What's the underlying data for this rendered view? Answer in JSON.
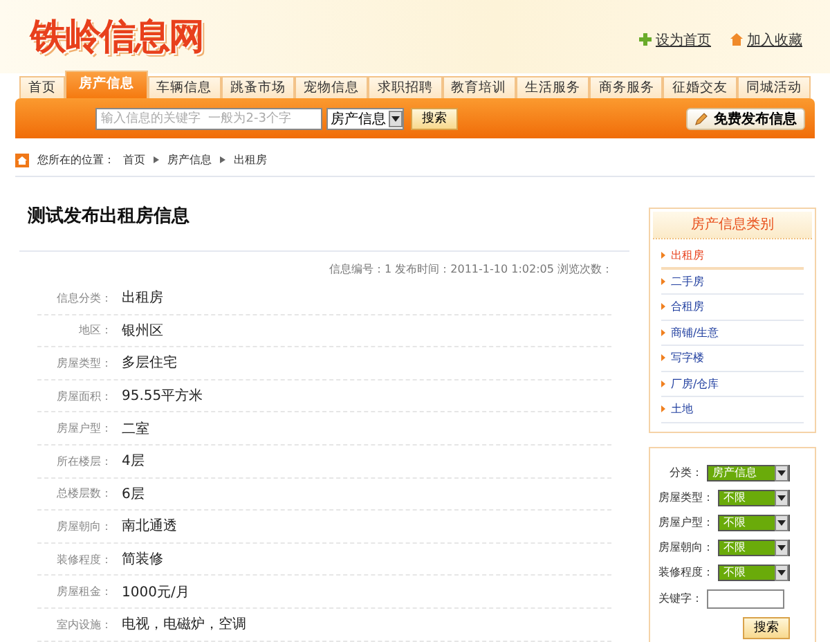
{
  "header": {
    "logo": "铁岭信息网",
    "links": [
      {
        "label": "设为首页",
        "kind": "home"
      },
      {
        "label": "加入收藏",
        "kind": "favorite"
      }
    ]
  },
  "nav": [
    {
      "label": "首页",
      "selected": false
    },
    {
      "label": "房产信息",
      "selected": true
    },
    {
      "label": "车辆信息",
      "selected": false
    },
    {
      "label": "跳蚤市场",
      "selected": false
    },
    {
      "label": "宠物信息",
      "selected": false
    },
    {
      "label": "求职招聘",
      "selected": false
    },
    {
      "label": "教育培训",
      "selected": false
    },
    {
      "label": "生活服务",
      "selected": false
    },
    {
      "label": "商务服务",
      "selected": false
    },
    {
      "label": "征婚交友",
      "selected": false
    },
    {
      "label": "同城活动",
      "selected": false
    }
  ],
  "search": {
    "placeholder": "输入信息的关键字  一般为2-3个字",
    "category": "房产信息",
    "button": "搜索",
    "publish": "免费发布信息"
  },
  "breadcrumb": {
    "prefix": "您所在的位置：",
    "items": [
      "首页",
      "房产信息",
      "出租房"
    ]
  },
  "article": {
    "title": "测试发布出租房信息",
    "meta": "信息编号：1  发布时间：2011-1-10 1:02:05  浏览次数：",
    "fields": [
      {
        "label": "信息分类：",
        "value": "出租房"
      },
      {
        "label": "地区：",
        "value": "银州区"
      },
      {
        "label": "房屋类型：",
        "value": "多层住宅"
      },
      {
        "label": "房屋面积：",
        "value": "95.55平方米"
      },
      {
        "label": "房屋户型：",
        "value": "二室"
      },
      {
        "label": "所在楼层：",
        "value": "4层"
      },
      {
        "label": "总楼层数：",
        "value": "6层"
      },
      {
        "label": "房屋朝向：",
        "value": "南北通透"
      },
      {
        "label": "装修程度：",
        "value": "简装修"
      },
      {
        "label": "房屋租金：",
        "value": "1000元/月"
      },
      {
        "label": "室内设施：",
        "value": "电视，电磁炉，空调"
      }
    ]
  },
  "sidebar": {
    "title": "房产信息类别",
    "categories": [
      {
        "label": "出租房",
        "selected": true
      },
      {
        "label": "二手房",
        "selected": false
      },
      {
        "label": "合租房",
        "selected": false
      },
      {
        "label": "商铺/生意",
        "selected": false
      },
      {
        "label": "写字楼",
        "selected": false
      },
      {
        "label": "厂房/仓库",
        "selected": false
      },
      {
        "label": "土地",
        "selected": false
      }
    ],
    "filters": [
      {
        "label": "分类：",
        "value": "房产信息"
      },
      {
        "label": "房屋类型：",
        "value": "不限"
      },
      {
        "label": "房屋户型：",
        "value": "不限"
      },
      {
        "label": "房屋朝向：",
        "value": "不限"
      },
      {
        "label": "装修程度：",
        "value": "不限"
      }
    ],
    "keyword_label": "关键字：",
    "button": "搜索"
  }
}
